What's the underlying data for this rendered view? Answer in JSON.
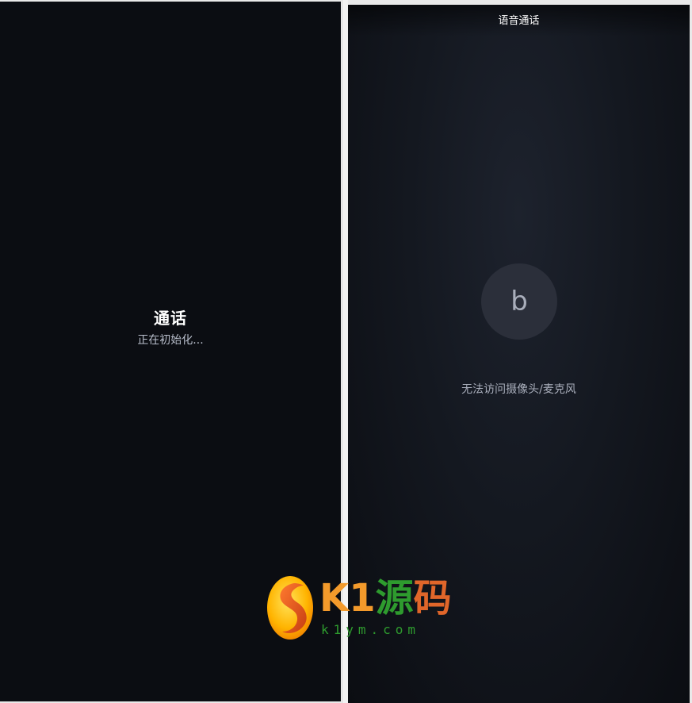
{
  "left_panel": {
    "title": "通话",
    "status": "正在初始化..."
  },
  "right_panel": {
    "title": "语音通话",
    "avatar_letter": "b",
    "media_error": "无法访问摄像头/麦克风"
  },
  "watermark": {
    "brand_k1": "K1",
    "brand_yuan": "源",
    "brand_ma": "码",
    "domain": "k1ym.com",
    "logo_icon": "k1-logo-icon"
  },
  "colors": {
    "panel_bg": "#0b0d12",
    "avatar_bg": "#2b2f3a",
    "muted_text": "#a9aebb",
    "watermark_orange": "#f39a2b",
    "watermark_green": "#2e9b2e"
  }
}
